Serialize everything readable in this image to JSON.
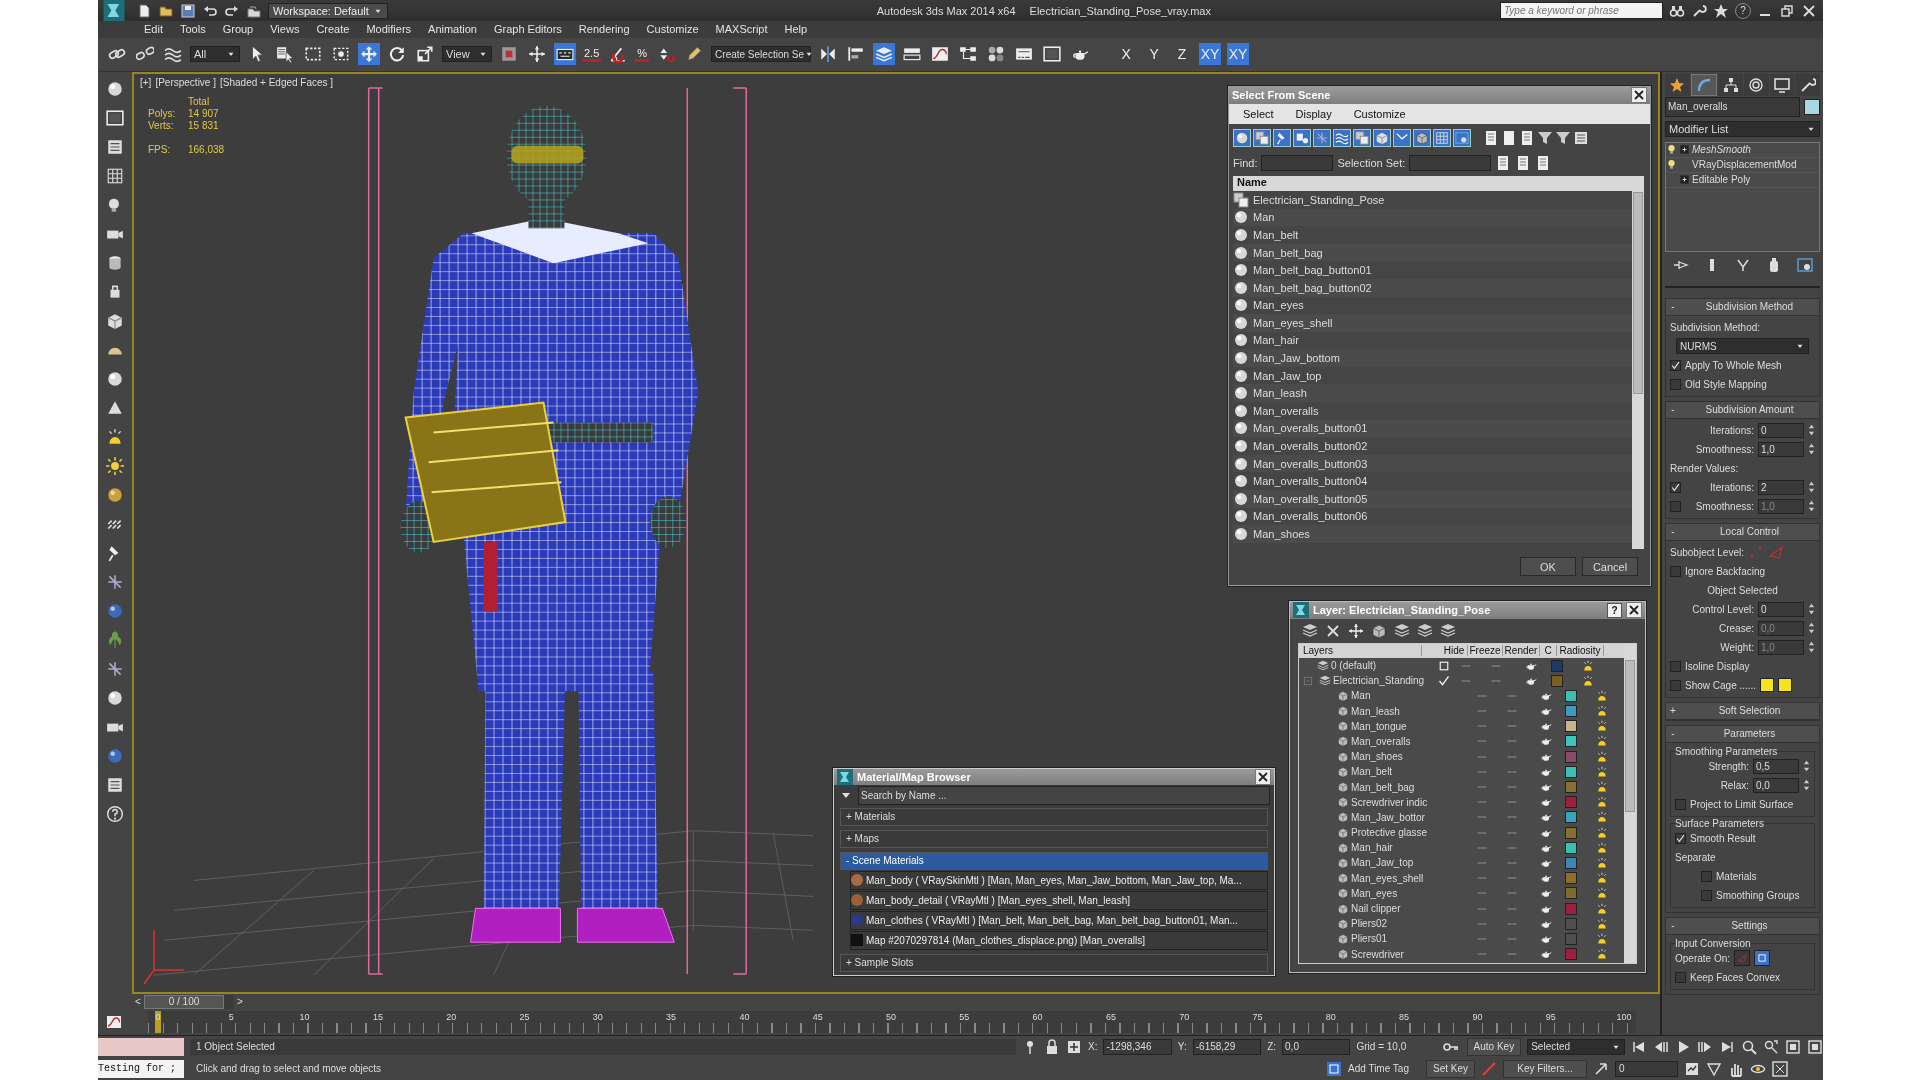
{
  "title_bar": {
    "workspace": "Workspace: Default",
    "app_title": "Autodesk 3ds Max  2014 x64",
    "file_name": "Electrician_Standing_Pose_vray.max",
    "search": {
      "placeholder": "Type a keyword or phrase"
    },
    "help": "?"
  },
  "menu": [
    "Edit",
    "Tools",
    "Group",
    "Views",
    "Create",
    "Modifiers",
    "Animation",
    "Graph Editors",
    "Rendering",
    "Customize",
    "MAXScript",
    "Help"
  ],
  "main_toolbar": {
    "selection_filter": "All",
    "transform_tools": [
      {
        "selected": true
      },
      {
        "selected": false
      },
      {
        "selected": false
      }
    ],
    "reference_coordinate": "View",
    "keyboard_override": {
      "on": true
    },
    "snap_3d": "2.5",
    "percent_snap": "%",
    "named_selection": "Create Selection Se",
    "manager_toggle": {
      "on": true
    },
    "axis_buttons": [
      {
        "label": "X",
        "selected": false
      },
      {
        "label": "Y",
        "selected": false
      },
      {
        "label": "Z",
        "selected": false
      },
      {
        "label": "XY",
        "selected": true
      },
      {
        "label": "XY",
        "selected": true
      }
    ]
  },
  "viewport": {
    "labels": [
      "[+]",
      "[Perspective ]",
      "[Shaded + Edged Faces ]"
    ],
    "stats": {
      "header": "Total",
      "rows": [
        {
          "label": "Polys:",
          "value": "14 907"
        },
        {
          "label": "Verts:",
          "value": "15 831"
        }
      ],
      "fps_label": "FPS:",
      "fps_value": "166,038"
    }
  },
  "select_from_scene": {
    "title": "Select From Scene",
    "menus": [
      "Select",
      "Display",
      "Customize"
    ],
    "find_label": "Find:",
    "selection_set_label": "Selection Set:",
    "column": "Name",
    "items": [
      {
        "name": "Electrician_Standing_Pose",
        "kind": "group"
      },
      {
        "name": "Man",
        "kind": "object"
      },
      {
        "name": "Man_belt",
        "kind": "object"
      },
      {
        "name": "Man_belt_bag",
        "kind": "object"
      },
      {
        "name": "Man_belt_bag_button01",
        "kind": "object"
      },
      {
        "name": "Man_belt_bag_button02",
        "kind": "object"
      },
      {
        "name": "Man_eyes",
        "kind": "object"
      },
      {
        "name": "Man_eyes_shell",
        "kind": "object"
      },
      {
        "name": "Man_hair",
        "kind": "object"
      },
      {
        "name": "Man_Jaw_bottom",
        "kind": "object"
      },
      {
        "name": "Man_Jaw_top",
        "kind": "object"
      },
      {
        "name": "Man_leash",
        "kind": "object"
      },
      {
        "name": "Man_overalls",
        "kind": "object"
      },
      {
        "name": "Man_overalls_button01",
        "kind": "object"
      },
      {
        "name": "Man_overalls_button02",
        "kind": "object"
      },
      {
        "name": "Man_overalls_button03",
        "kind": "object"
      },
      {
        "name": "Man_overalls_button04",
        "kind": "object"
      },
      {
        "name": "Man_overalls_button05",
        "kind": "object"
      },
      {
        "name": "Man_overalls_button06",
        "kind": "object"
      },
      {
        "name": "Man_shoes",
        "kind": "object"
      }
    ],
    "buttons": [
      "OK",
      "Cancel"
    ]
  },
  "layer_manager": {
    "title": "Layer: Electrician_Standing_Pose",
    "help": "?",
    "columns": [
      "Layers",
      "Hide",
      "Freeze",
      "Render",
      "C",
      "Radiosity"
    ],
    "layers": [
      {
        "name": "0 (default)",
        "color": "#1f3a62",
        "current": false
      },
      {
        "name": "Electrician_Standing",
        "color": "#7a6020",
        "current": true,
        "expanded": true,
        "children": [
          {
            "name": "Man",
            "color": "#3cc0b4"
          },
          {
            "name": "Man_leash",
            "color": "#3a9cc0"
          },
          {
            "name": "Man_tongue",
            "color": "#c8b48c"
          },
          {
            "name": "Man_overalls",
            "color": "#40c4b8"
          },
          {
            "name": "Man_shoes",
            "color": "#8a4a6a"
          },
          {
            "name": "Man_belt",
            "color": "#3cc0b4"
          },
          {
            "name": "Man_belt_bag",
            "color": "#8a7030"
          },
          {
            "name": "Screwdriver indic",
            "color": "#a01e40"
          },
          {
            "name": "Man_Jaw_bottor",
            "color": "#3aa4bc"
          },
          {
            "name": "Protective glasse",
            "color": "#8a7030"
          },
          {
            "name": "Man_hair",
            "color": "#3cc0b4"
          },
          {
            "name": "Man_Jaw_top",
            "color": "#3a88b4"
          },
          {
            "name": "Man_eyes_shell",
            "color": "#8a7030"
          },
          {
            "name": "Man_eyes",
            "color": "#806a2c"
          },
          {
            "name": "Nail clipper",
            "color": "#a01e40"
          },
          {
            "name": "Pliers02",
            "color": "#505050"
          },
          {
            "name": "Pliers01",
            "color": "#505050"
          },
          {
            "name": "Screwdriver",
            "color": "#a01e40"
          }
        ]
      }
    ]
  },
  "material_browser": {
    "title": "Material/Map Browser",
    "search": {
      "placeholder": "Search by Name ..."
    },
    "groups": [
      {
        "label": "+ Materials",
        "expanded": false
      },
      {
        "label": "+ Maps",
        "expanded": false
      },
      {
        "label": "- Scene Materials",
        "expanded": true,
        "items": [
          {
            "text": "Man_body  ( VRaySkinMtl ) [Man, Man_eyes, Man_Jaw_bottom, Man_Jaw_top, Ma...",
            "kind": "material",
            "color": "#a86a40"
          },
          {
            "text": "Man_body_detail  ( VRayMtl ) [Man_eyes_shell, Man_leash]",
            "kind": "material",
            "color": "#9a6038"
          },
          {
            "text": "Man_clothes  ( VRayMtl ) [Man_belt, Man_belt_bag, Man_belt_bag_button01, Man...",
            "kind": "material",
            "color": "#2a3a88"
          },
          {
            "text": "Map #2070297814 (Man_clothes_displace.png) [Man_overalls]",
            "kind": "map",
            "color": "#111111"
          }
        ]
      },
      {
        "label": "+ Sample Slots",
        "expanded": false
      }
    ]
  },
  "command_panel": {
    "tabs": [
      {
        "selected": false
      },
      {
        "selected": true
      },
      {
        "selected": false
      },
      {
        "selected": false
      },
      {
        "selected": false
      },
      {
        "selected": false
      }
    ],
    "object": {
      "name": "Man_overalls",
      "color": "#a8d8e0"
    },
    "modifier_list": "Modifier List",
    "stack": [
      {
        "name": "MeshSmooth",
        "bulb": true,
        "expandable": true,
        "instanced": true
      },
      {
        "name": "VRayDisplacementMod",
        "bulb": true,
        "expandable": false,
        "instanced": false
      },
      {
        "name": "Editable Poly",
        "bulb": false,
        "expandable": true,
        "instanced": false
      }
    ],
    "rollouts": [
      {
        "toggle": "-",
        "title": "Subdivision Method",
        "rows": [
          {
            "kind": "label",
            "text": "Subdivision Method:"
          },
          {
            "kind": "dropdown",
            "value": "NURMS"
          },
          {
            "kind": "checkbox",
            "label": "Apply To Whole Mesh",
            "checked": true
          },
          {
            "kind": "checkbox",
            "label": "Old Style Mapping",
            "checked": false
          }
        ]
      },
      {
        "toggle": "-",
        "title": "Subdivision Amount",
        "rows": [
          {
            "kind": "spinner",
            "label": "Iterations:",
            "value": "0"
          },
          {
            "kind": "spinner",
            "label": "Smoothness:",
            "value": "1,0"
          },
          {
            "kind": "label",
            "text": "Render Values:"
          },
          {
            "kind": "check_spinner",
            "label": "Iterations:",
            "value": "2",
            "checked": true
          },
          {
            "kind": "check_spinner",
            "label": "Smoothness:",
            "value": "1,0",
            "checked": false
          }
        ]
      },
      {
        "toggle": "-",
        "title": "Local Control",
        "rows": [
          {
            "kind": "subobject",
            "text": "Subobject Level:"
          },
          {
            "kind": "checkbox",
            "label": "Ignore Backfacing",
            "checked": false
          },
          {
            "kind": "center",
            "text": "Object Selected"
          },
          {
            "kind": "spinner",
            "label": "Control Level:",
            "value": "0"
          },
          {
            "kind": "spinner",
            "label": "Crease:",
            "value": "0,0",
            "disabled": true
          },
          {
            "kind": "spinner",
            "label": "Weight:",
            "value": "1,0",
            "disabled": true
          },
          {
            "kind": "checkbox",
            "label": "Isoline Display",
            "checked": false
          },
          {
            "kind": "swatches",
            "label": "Show Cage ......",
            "checked": false,
            "swatches": [
              {
                "color": "#f5e41e"
              },
              {
                "color": "#f5e41e"
              }
            ]
          }
        ]
      },
      {
        "toggle": "+",
        "title": "Soft Selection"
      },
      {
        "toggle": "-",
        "title": "Parameters",
        "rows": [
          {
            "kind": "group",
            "title": "Smoothing Parameters",
            "rows": [
              {
                "kind": "spinner",
                "label": "Strength:",
                "value": "0,5"
              },
              {
                "kind": "spinner",
                "label": "Relax:",
                "value": "0,0"
              },
              {
                "kind": "checkbox",
                "label": "Project to Limit Surface",
                "checked": false
              }
            ]
          },
          {
            "kind": "group",
            "title": "Surface Parameters",
            "rows": [
              {
                "kind": "checkbox",
                "label": "Smooth Result",
                "checked": true
              },
              {
                "kind": "label",
                "text": "Separate"
              },
              {
                "kind": "sub_checkbox",
                "label": "Materials",
                "checked": false
              },
              {
                "kind": "sub_checkbox",
                "label": "Smoothing Groups",
                "checked": false
              }
            ]
          }
        ]
      },
      {
        "toggle": "-",
        "title": "Settings",
        "rows": [
          {
            "kind": "group",
            "title": "Input Conversion",
            "rows": [
              {
                "kind": "operate",
                "label": "Operate On:",
                "options": [
                  {
                    "selected": false
                  },
                  {
                    "selected": true
                  }
                ]
              },
              {
                "kind": "checkbox",
                "label": "Keep Faces Convex",
                "checked": false
              }
            ]
          }
        ]
      }
    ]
  },
  "timeline": {
    "prev": "<",
    "position": "0 / 100",
    "next": ">",
    "level": 0,
    "ticks": [
      "0",
      "5",
      "10",
      "15",
      "20",
      "25",
      "30",
      "35",
      "40",
      "45",
      "50",
      "55",
      "60",
      "65",
      "70",
      "75",
      "80",
      "85",
      "90",
      "95",
      "100"
    ]
  },
  "status": {
    "listener": "Testing for ;",
    "selection": "1 Object Selected",
    "prompt": "Click and drag to select and move objects",
    "coords": [
      {
        "label": "X:",
        "value": "-1298,346"
      },
      {
        "label": "Y:",
        "value": "-6158,29"
      },
      {
        "label": "Z:",
        "value": "0,0"
      }
    ],
    "grid": "Grid = 10,0",
    "add_time_tag": "Add Time Tag",
    "auto_key": {
      "label": "Auto Key",
      "on": false
    },
    "set_key": "Set Key",
    "key_mode": "Selected",
    "key_filters": "Key Filters...",
    "frame": "0"
  }
}
